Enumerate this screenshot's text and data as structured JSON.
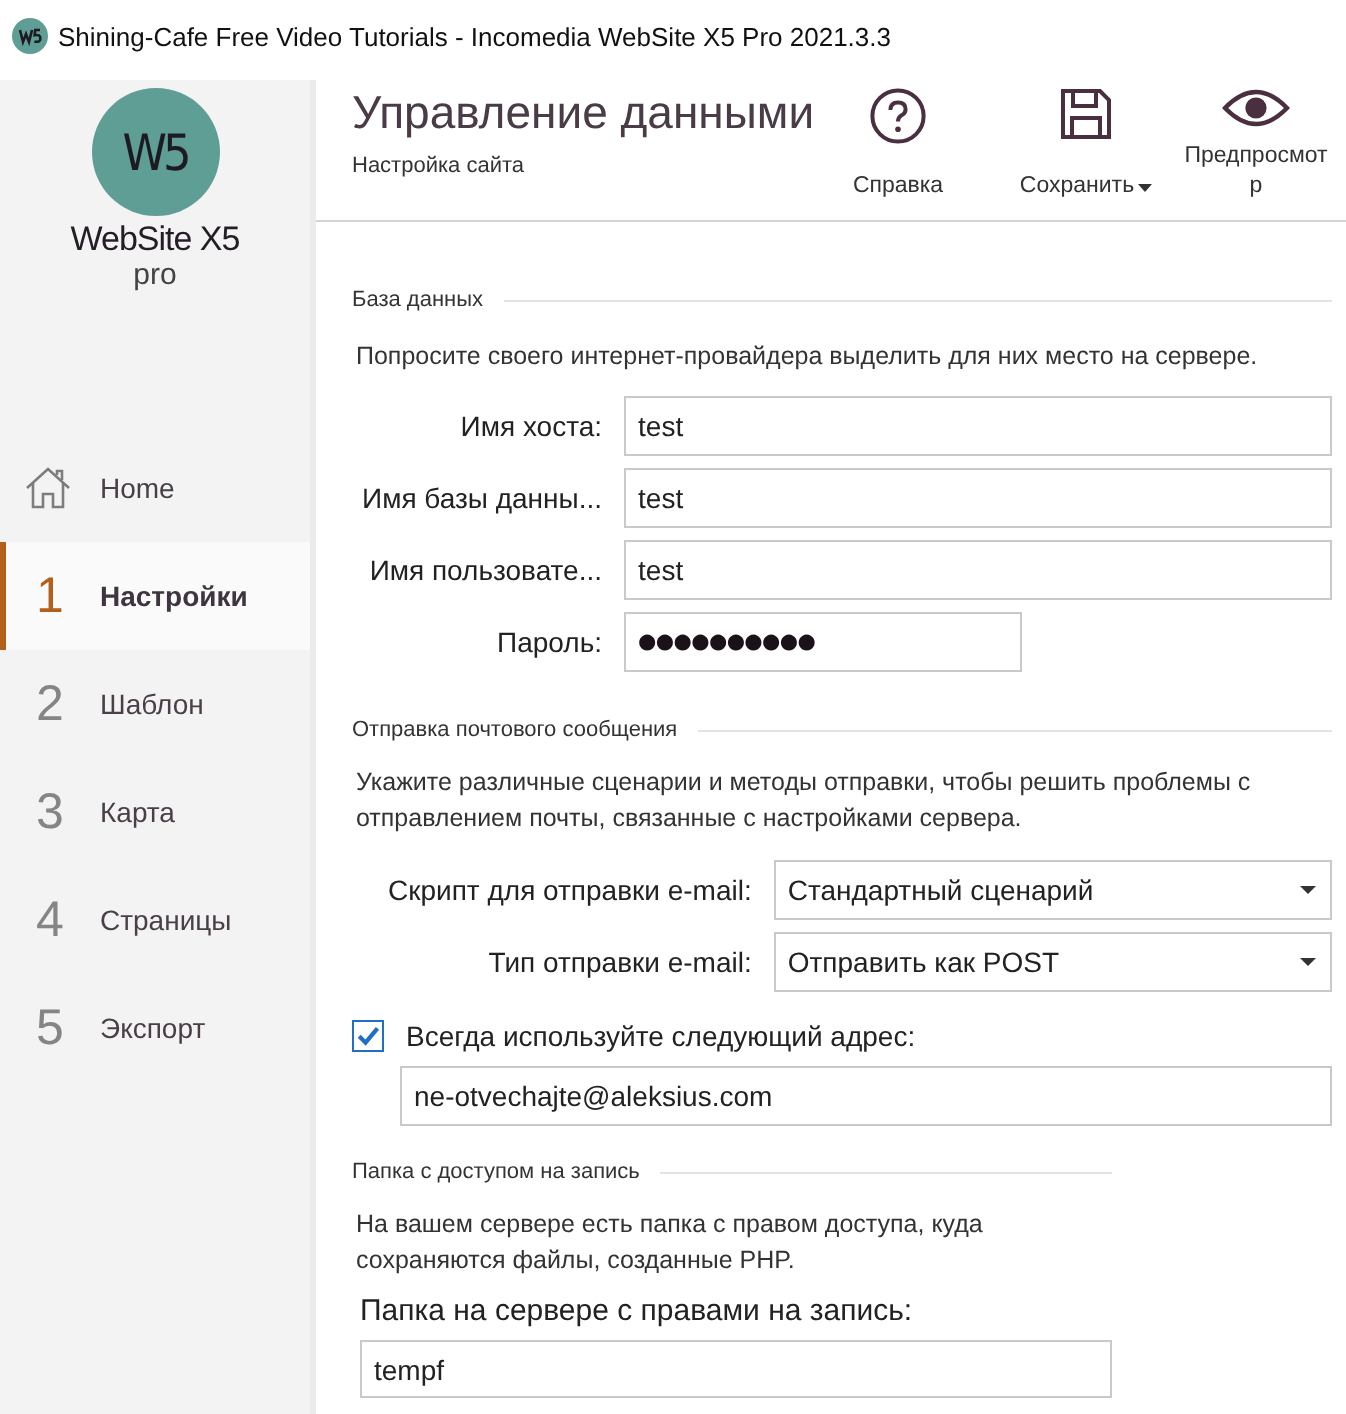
{
  "window": {
    "title": "Shining-Cafe Free Video Tutorials - Incomedia WebSite X5 Pro 2021.3.3"
  },
  "logo": {
    "mark": "W5",
    "name": "WebSite X5",
    "edition": "pro"
  },
  "sidebar": {
    "items": [
      {
        "kind": "home",
        "label": "Home",
        "selected": false
      },
      {
        "kind": "step",
        "number": "1",
        "label": "Настройки",
        "selected": true
      },
      {
        "kind": "step",
        "number": "2",
        "label": "Шаблон",
        "selected": false
      },
      {
        "kind": "step",
        "number": "3",
        "label": "Карта",
        "selected": false
      },
      {
        "kind": "step",
        "number": "4",
        "label": "Страницы",
        "selected": false
      },
      {
        "kind": "step",
        "number": "5",
        "label": "Экспорт",
        "selected": false
      }
    ]
  },
  "header": {
    "title": "Управление данными",
    "subtitle": "Настройка сайта"
  },
  "toolbar": [
    {
      "kind": "help",
      "label": "Справка",
      "dropdown": false
    },
    {
      "kind": "save",
      "label": "Сохранить",
      "dropdown": true
    },
    {
      "kind": "preview",
      "label": "Предпросмотр",
      "dropdown": false
    }
  ],
  "sections": [
    {
      "title": "База данных",
      "description": "Попросите своего интернет-провайдера выделить для них место на сервере.",
      "fields": [
        {
          "kind": "text",
          "label": "Имя хоста:",
          "value": "test"
        },
        {
          "kind": "text",
          "label": "Имя базы данны...",
          "value": "test"
        },
        {
          "kind": "text",
          "label": "Имя пользовате...",
          "value": "test"
        },
        {
          "kind": "password",
          "label": "Пароль:",
          "value": "●●●●●●●●●●"
        }
      ]
    },
    {
      "title": "Отправка почтового сообщения",
      "description": "Укажите различные сценарии и методы отправки, чтобы решить проблемы с отправлением почты, связанные с настройками сервера.",
      "fields": [
        {
          "kind": "select",
          "label": "Скрипт для отправки e-mail:",
          "value": "Стандартный сценарий"
        },
        {
          "kind": "select",
          "label": "Тип отправки e-mail:",
          "value": "Отправить как POST"
        },
        {
          "kind": "checkbox",
          "label": "Всегда используйте следующий адрес:",
          "checked": true,
          "value": "ne-otvechajte@aleksius.com"
        }
      ]
    },
    {
      "title": "Папка с доступом на запись",
      "description": "На вашем сервере есть папка с правом доступа, куда сохраняются файлы, созданные PHP.",
      "fields": [
        {
          "kind": "stacked",
          "label": "Папка на сервере с правами на запись:",
          "value": "tempf"
        }
      ]
    }
  ]
}
